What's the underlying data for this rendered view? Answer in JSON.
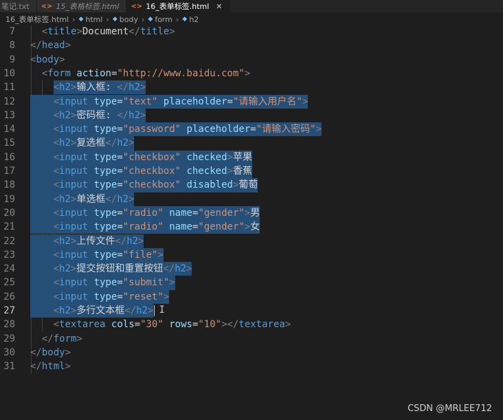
{
  "tabs": [
    {
      "label": "笔记.txt",
      "icon": "",
      "style": "plain"
    },
    {
      "label": "15_表格标签.html",
      "icon": "<>",
      "style": "italic"
    },
    {
      "label": "16_表单标签.html",
      "icon": "<>",
      "style": "active",
      "close": "✕"
    }
  ],
  "breadcrumb": {
    "file": "16_表单标签.html",
    "items": [
      "html",
      "body",
      "form",
      "h2"
    ]
  },
  "editor": {
    "current_line": "27",
    "lines": [
      {
        "num": "7",
        "text": "<title>Document</title>"
      },
      {
        "num": "8",
        "text": "</head>"
      },
      {
        "num": "9",
        "text": "<body>"
      },
      {
        "num": "10",
        "text": "<form action=\"http://www.baidu.com\">"
      },
      {
        "num": "11",
        "text": "<h2>输入框: </h2>"
      },
      {
        "num": "12",
        "text": "<input type=\"text\" placeholder=\"请输入用户名\">"
      },
      {
        "num": "13",
        "text": "<h2>密码框: </h2>"
      },
      {
        "num": "14",
        "text": "<input type=\"password\" placeholder=\"请输入密码\">"
      },
      {
        "num": "15",
        "text": "<h2>复选框</h2>"
      },
      {
        "num": "16",
        "text": "<input type=\"checkbox\" checked>苹果"
      },
      {
        "num": "17",
        "text": "<input type=\"checkbox\" checked>香蕉"
      },
      {
        "num": "18",
        "text": "<input type=\"checkbox\" disabled>葡萄"
      },
      {
        "num": "19",
        "text": "<h2>单选框</h2>"
      },
      {
        "num": "20",
        "text": "<input type=\"radio\" name=\"gender\">男"
      },
      {
        "num": "21",
        "text": "<input type=\"radio\" name=\"gender\">女"
      },
      {
        "num": "22",
        "text": "<h2>上传文件</h2>"
      },
      {
        "num": "23",
        "text": "<input type=\"file\">"
      },
      {
        "num": "24",
        "text": "<h2>提交按钮和重置按钮</h2>"
      },
      {
        "num": "25",
        "text": "<input type=\"submit\">"
      },
      {
        "num": "26",
        "text": "<input type=\"reset\">"
      },
      {
        "num": "27",
        "text": "<h2>多行文本框</h2>"
      },
      {
        "num": "28",
        "text": "<textarea cols=\"30\" rows=\"10\"></textarea>"
      },
      {
        "num": "29",
        "text": "</form>"
      },
      {
        "num": "30",
        "text": "</body>"
      },
      {
        "num": "31",
        "text": "</html>"
      }
    ]
  },
  "watermark": "CSDN @MRLEE712",
  "colors": {
    "background": "#1e1e1e",
    "selection": "#264f78",
    "tag": "#569cd6",
    "attribute": "#9cdcfe",
    "string": "#ce9178",
    "bracket": "#808080"
  }
}
